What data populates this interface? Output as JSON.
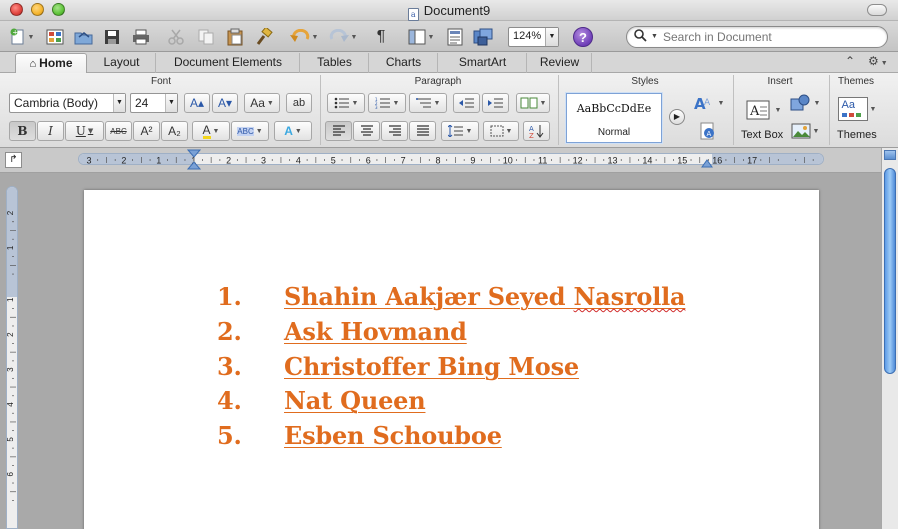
{
  "window": {
    "title": "Document9",
    "doc_icon_glyph": "a"
  },
  "toolbar": {
    "zoom_value": "124%",
    "help_glyph": "?",
    "search_placeholder": "Search in Document",
    "pilcrow_glyph": "¶"
  },
  "tabs": [
    {
      "label": "Home",
      "active": true
    },
    {
      "label": "Layout",
      "active": false
    },
    {
      "label": "Document Elements",
      "active": false
    },
    {
      "label": "Tables",
      "active": false
    },
    {
      "label": "Charts",
      "active": false
    },
    {
      "label": "SmartArt",
      "active": false
    },
    {
      "label": "Review",
      "active": false
    }
  ],
  "ribbon": {
    "groups": {
      "font": "Font",
      "paragraph": "Paragraph",
      "styles": "Styles",
      "insert": "Insert",
      "themes": "Themes"
    },
    "font_name": "Cambria (Body)",
    "font_size": "24",
    "format_buttons": {
      "bold": "B",
      "italic": "I",
      "underline": "U",
      "strike": "ABC",
      "superscript": "A²",
      "subscript": "A₂",
      "text_color": "A",
      "highlight": "ABC",
      "text_effects": "A"
    },
    "size_buttons": {
      "grow": "A▴",
      "shrink": "A▾",
      "change_case": "Aa",
      "clear": "ab"
    },
    "style_sample": "AaBbCcDdEe",
    "style_name": "Normal",
    "insert_text_box": "Text Box",
    "themes_label": "Themes",
    "themes_sample": "Aa"
  },
  "accent_color": "#e06c1e",
  "ruler": {
    "h_ticks": [
      "3",
      "2",
      "1",
      "1",
      "2",
      "3",
      "4",
      "5",
      "6",
      "7",
      "8",
      "9",
      "10",
      "11",
      "12",
      "13",
      "14",
      "15",
      "16",
      "17"
    ],
    "v_ticks": [
      "2",
      "1",
      "1",
      "2",
      "3",
      "4",
      "5",
      "6"
    ]
  },
  "document": {
    "list": [
      {
        "number": "1.",
        "text": "Shahin Aakjær Seyed ",
        "text_flagged": "Nasrolla"
      },
      {
        "number": "2.",
        "text": "Ask Hovmand",
        "text_flagged": ""
      },
      {
        "number": "3.",
        "text": "Christoffer Bing Mose",
        "text_flagged": ""
      },
      {
        "number": "4.",
        "text": "Nat Queen",
        "text_flagged": ""
      },
      {
        "number": "5.",
        "text": "Esben Schouboe",
        "text_flagged": ""
      }
    ]
  }
}
